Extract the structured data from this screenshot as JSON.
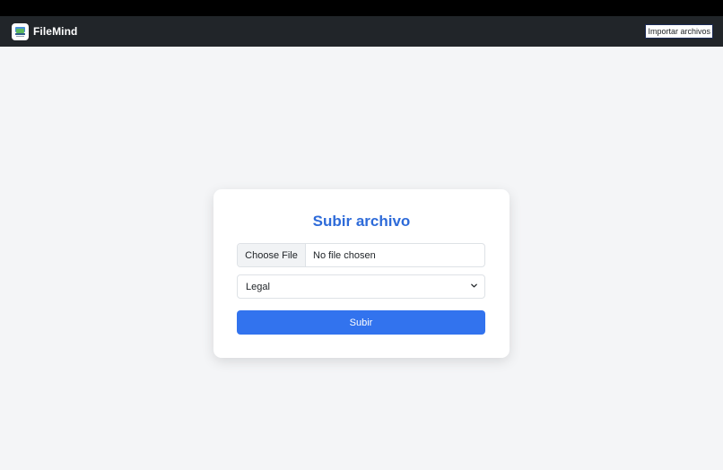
{
  "app": {
    "name": "FileMind",
    "logo_icon": "filemind-logo-icon",
    "import_button_label": "Importar archivos"
  },
  "upload_card": {
    "title": "Subir archivo",
    "file_input": {
      "button_label": "Choose File",
      "status": "No file chosen"
    },
    "category_select": {
      "selected": "Legal",
      "icon": "chevron-down-icon"
    },
    "submit_label": "Subir"
  },
  "colors": {
    "navbar": "#212529",
    "accent": "#3273ee",
    "title": "#2e6bd9",
    "background": "#f4f5f7"
  }
}
